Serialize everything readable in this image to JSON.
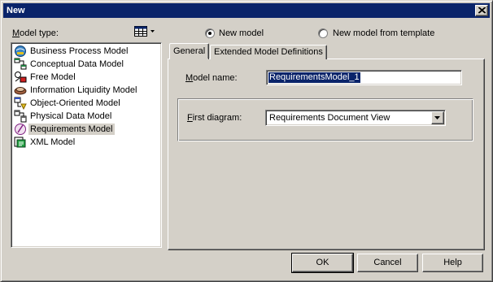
{
  "window": {
    "title": "New"
  },
  "model_type": {
    "label": "Model type:",
    "view_icon": "list-view-icon"
  },
  "radios": [
    {
      "label": "New model",
      "selected": true
    },
    {
      "label": "New model from template",
      "selected": false
    }
  ],
  "models": [
    {
      "label": "Business Process Model",
      "icon": "business-process-model-icon"
    },
    {
      "label": "Conceptual Data Model",
      "icon": "conceptual-data-model-icon"
    },
    {
      "label": "Free Model",
      "icon": "free-model-icon"
    },
    {
      "label": "Information Liquidity Model",
      "icon": "information-liquidity-model-icon"
    },
    {
      "label": "Object-Oriented Model",
      "icon": "object-oriented-model-icon"
    },
    {
      "label": "Physical Data Model",
      "icon": "physical-data-model-icon"
    },
    {
      "label": "Requirements Model",
      "icon": "requirements-model-icon",
      "selected": true
    },
    {
      "label": "XML Model",
      "icon": "xml-model-icon"
    }
  ],
  "tabs": [
    {
      "label": "General",
      "active": true
    },
    {
      "label": "Extended Model Definitions",
      "active": false
    }
  ],
  "general": {
    "model_name_label": "Model name:",
    "model_name_value": "RequirementsModel_1",
    "first_diagram_label": "First diagram:",
    "first_diagram_value": "Requirements Document View"
  },
  "buttons": {
    "ok": "OK",
    "cancel": "Cancel",
    "help": "Help"
  },
  "colors": {
    "titlebar": "#0a246a",
    "face": "#d4d0c8",
    "selection": "#0a246a"
  }
}
